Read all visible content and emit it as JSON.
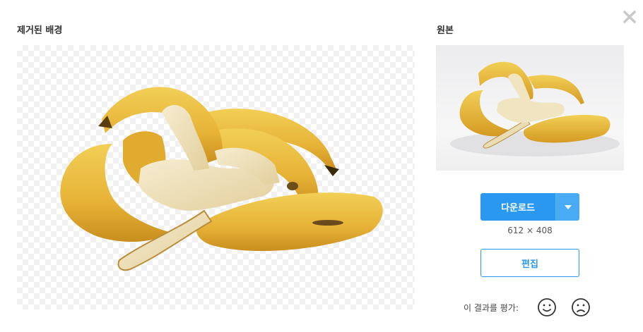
{
  "left_panel": {
    "title": "제거된 배경"
  },
  "right_panel": {
    "title": "원본"
  },
  "download": {
    "label": "다운로드",
    "dimensions": "612 × 408"
  },
  "edit": {
    "label": "편집"
  },
  "rating": {
    "label": "이 결과를 평가:"
  },
  "icons": {
    "close": "close-icon",
    "dropdown": "chevron-down-icon",
    "happy": "smile-icon",
    "sad": "frown-icon"
  },
  "colors": {
    "accent": "#2b98f0",
    "accent_light": "#4aabf5",
    "banana": "#e8b53a"
  }
}
